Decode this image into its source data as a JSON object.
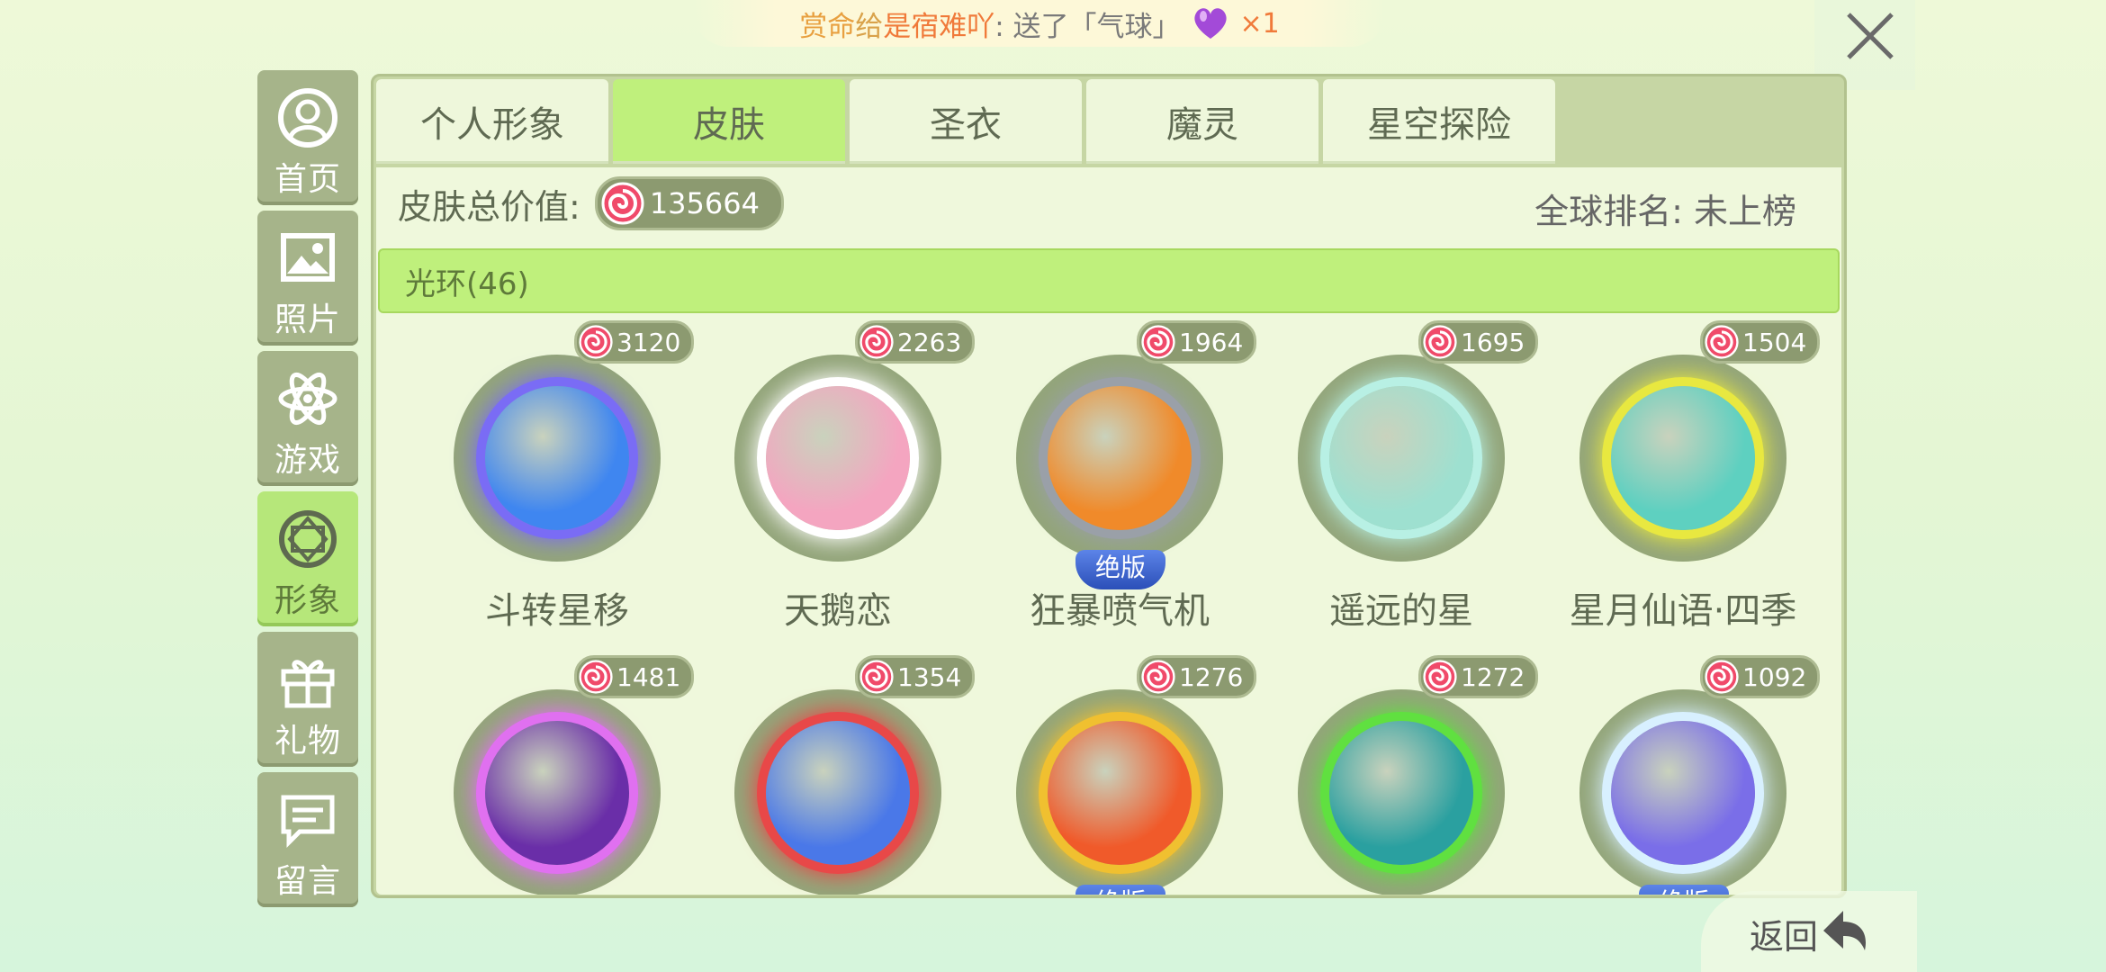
{
  "notice": {
    "part1": "赏命",
    "part2": "给",
    "part3": "是宿难吖",
    "part4": ":  送了「气球」",
    "count": "×1",
    "icon": "purple-heart-balloon-icon"
  },
  "sidebar": [
    {
      "label": "首页",
      "icon": "avatar-icon"
    },
    {
      "label": "照片",
      "icon": "photo-icon"
    },
    {
      "label": "游戏",
      "icon": "atom-icon"
    },
    {
      "label": "形象",
      "icon": "diamond-icon",
      "active": true
    },
    {
      "label": "礼物",
      "icon": "gift-icon"
    },
    {
      "label": "留言",
      "icon": "message-icon"
    }
  ],
  "tabs": [
    {
      "label": "个人形象"
    },
    {
      "label": "皮肤",
      "active": true
    },
    {
      "label": "圣衣"
    },
    {
      "label": "魔灵"
    },
    {
      "label": "星空探险"
    }
  ],
  "summary": {
    "label": "皮肤总价值:",
    "value": "135664",
    "rank": "全球排名: 未上榜"
  },
  "category": {
    "label": "光环(46)"
  },
  "items": [
    {
      "name": "斗转星移",
      "price": "3120",
      "color": "#3f86f0",
      "glow": "#7a6cf5"
    },
    {
      "name": "天鹅恋",
      "price": "2263",
      "color": "#f4a5c0",
      "glow": "#ffffff"
    },
    {
      "name": "狂暴喷气机",
      "price": "1964",
      "color": "#f08a2a",
      "glow": "#9aa0a8",
      "badge": "绝版"
    },
    {
      "name": "遥远的星",
      "price": "1695",
      "color": "#9ee0d0",
      "glow": "#b8f0e4"
    },
    {
      "name": "星月仙语·四季",
      "price": "1504",
      "color": "#5ed0c0",
      "glow": "#e8e840"
    },
    {
      "name": "",
      "price": "1481",
      "color": "#6a2ea8",
      "glow": "#e070f0"
    },
    {
      "name": "",
      "price": "1354",
      "color": "#4a78e8",
      "glow": "#e84848"
    },
    {
      "name": "",
      "price": "1276",
      "color": "#f05a2a",
      "glow": "#f0c030",
      "badge": "绝版"
    },
    {
      "name": "",
      "price": "1272",
      "color": "#2aa0a0",
      "glow": "#60e040"
    },
    {
      "name": "",
      "price": "1092",
      "color": "#7a6ee8",
      "glow": "#d8f0ff",
      "badge": "绝版"
    }
  ],
  "back": {
    "label": "返回"
  }
}
